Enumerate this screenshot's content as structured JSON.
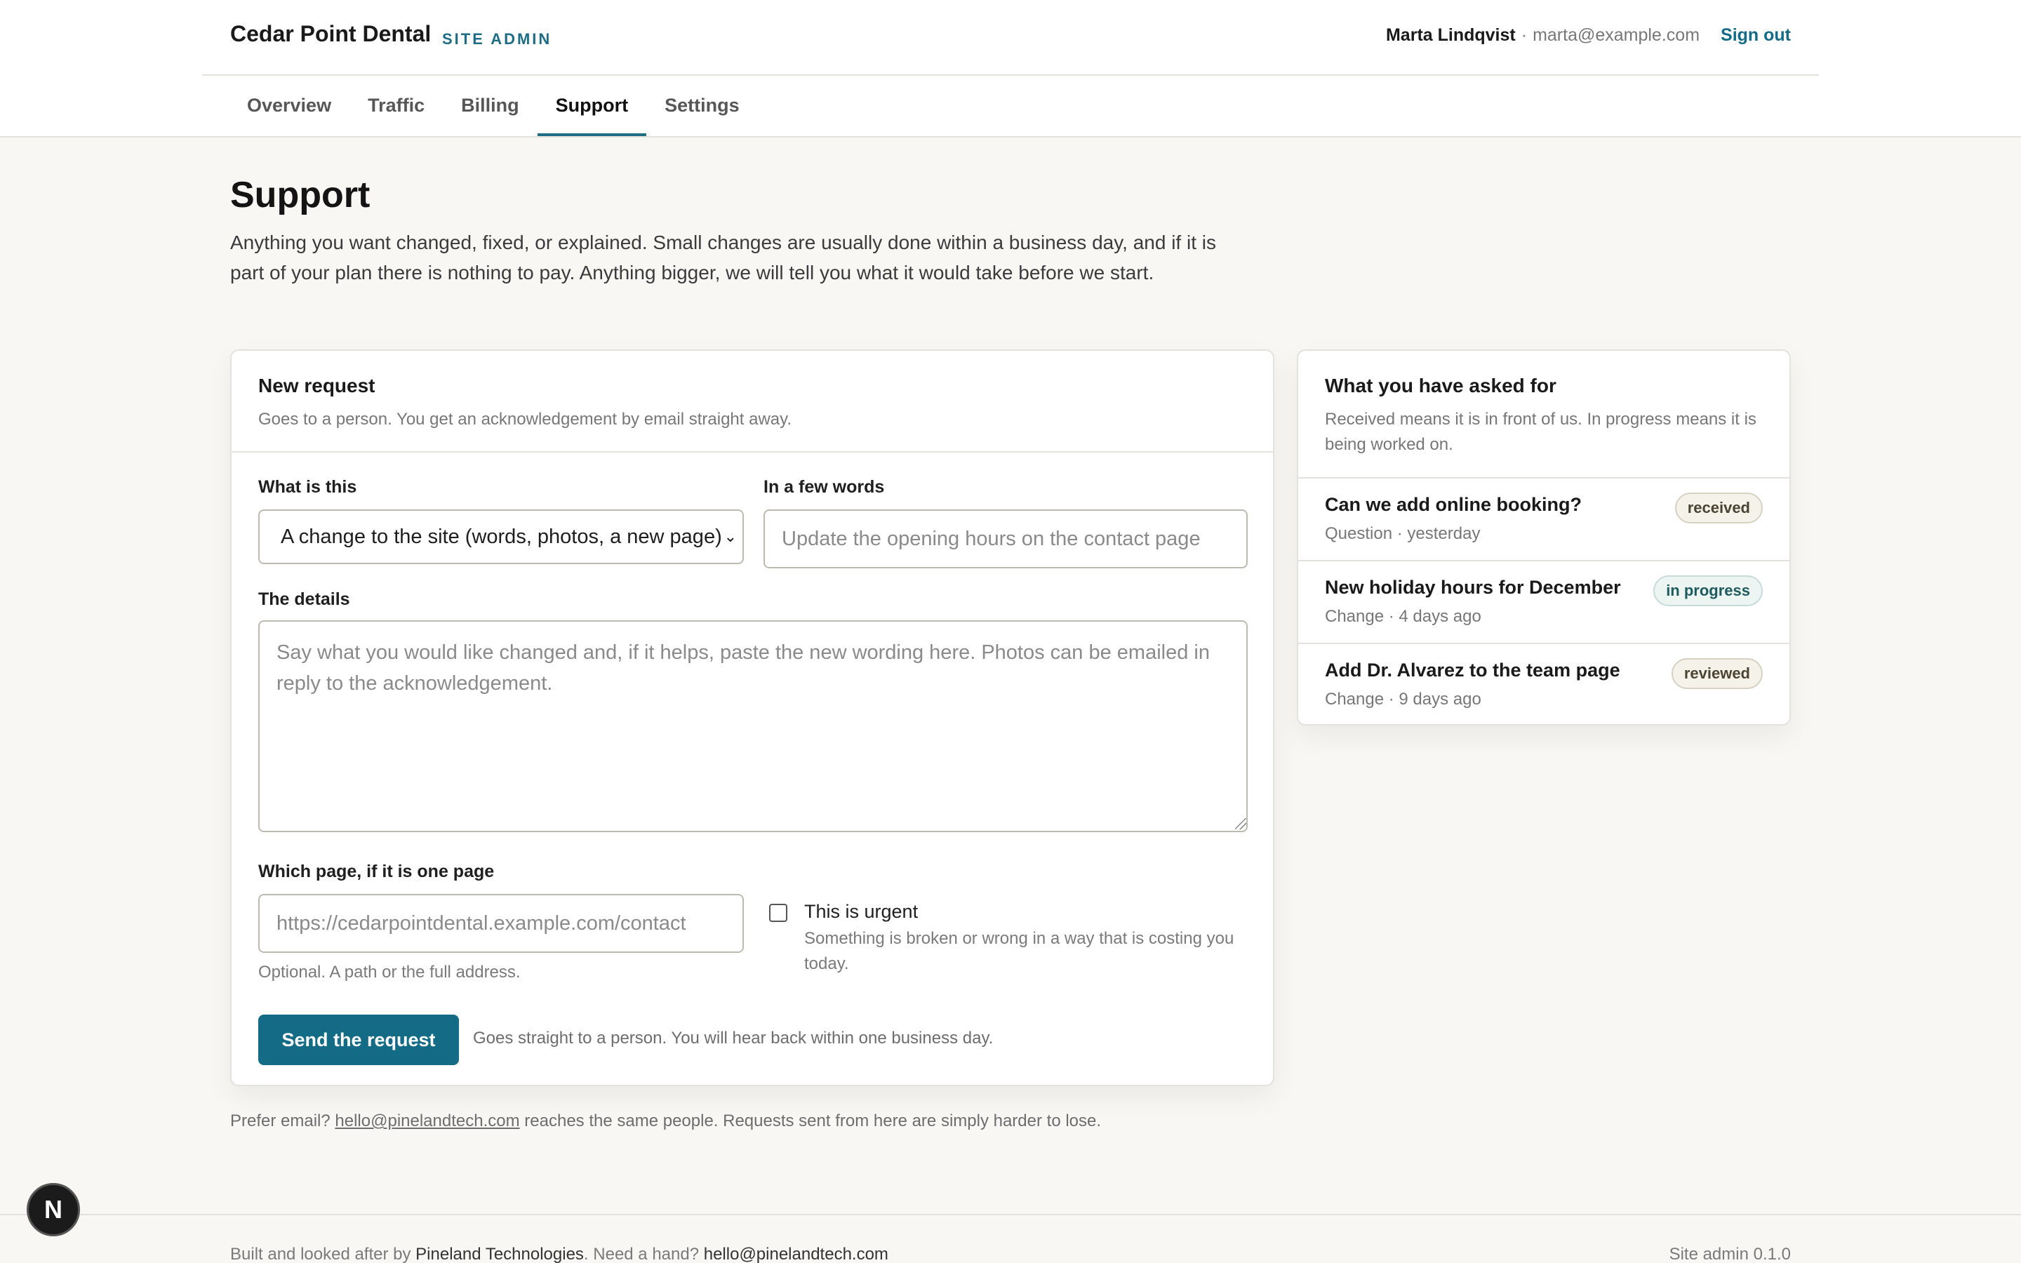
{
  "header": {
    "brand": "Cedar Point Dental",
    "brand_sub": "SITE ADMIN",
    "user_name": "Marta Lindqvist",
    "separator": "·",
    "user_email": "marta@example.com",
    "sign_out": "Sign out"
  },
  "nav": {
    "tabs": [
      {
        "label": "Overview",
        "active": false
      },
      {
        "label": "Traffic",
        "active": false
      },
      {
        "label": "Billing",
        "active": false
      },
      {
        "label": "Support",
        "active": true
      },
      {
        "label": "Settings",
        "active": false
      }
    ]
  },
  "page": {
    "title": "Support",
    "intro": "Anything you want changed, fixed, or explained. Small changes are usually done within a business day, and if it is part of your plan there is nothing to pay. Anything bigger, we will tell you what it would take before we start."
  },
  "request_form": {
    "title": "New request",
    "subtitle": "Goes to a person. You get an acknowledgement by email straight away.",
    "type_label": "What is this",
    "type_value": "A change to the site (words, photos, a new page)",
    "summary_label": "In a few words",
    "summary_placeholder": "Update the opening hours on the contact page",
    "details_label": "The details",
    "details_placeholder": "Say what you would like changed and, if it helps, paste the new wording here. Photos can be emailed in reply to the acknowledgement.",
    "page_label": "Which page, if it is one page",
    "page_placeholder": "https://cedarpointdental.example.com/contact",
    "page_help": "Optional. A path or the full address.",
    "urgent_label": "This is urgent",
    "urgent_help": "Something is broken or wrong in a way that is costing you today.",
    "send_button": "Send the request",
    "send_note": "Goes straight to a person. You will hear back within one business day."
  },
  "history": {
    "title": "What you have asked for",
    "subtitle": "Received means it is in front of us. In progress means it is being worked on.",
    "items": [
      {
        "title": "Can we add online booking?",
        "meta": "Question · yesterday",
        "status": "received"
      },
      {
        "title": "New holiday hours for December",
        "meta": "Change · 4 days ago",
        "status": "in progress"
      },
      {
        "title": "Add Dr. Alvarez to the team page",
        "meta": "Change · 9 days ago",
        "status": "reviewed"
      }
    ]
  },
  "prefer": {
    "prefix": "Prefer email?",
    "email": "hello@pinelandtech.com",
    "suffix": "reaches the same people. Requests sent from here are simply harder to lose."
  },
  "footer": {
    "built_prefix": "Built and looked after by",
    "company": "Pineland Technologies",
    "help_prefix": ". Need a hand?",
    "help_email": "hello@pinelandtech.com",
    "version": "Site admin 0.1.0"
  },
  "dev_badge": "N"
}
